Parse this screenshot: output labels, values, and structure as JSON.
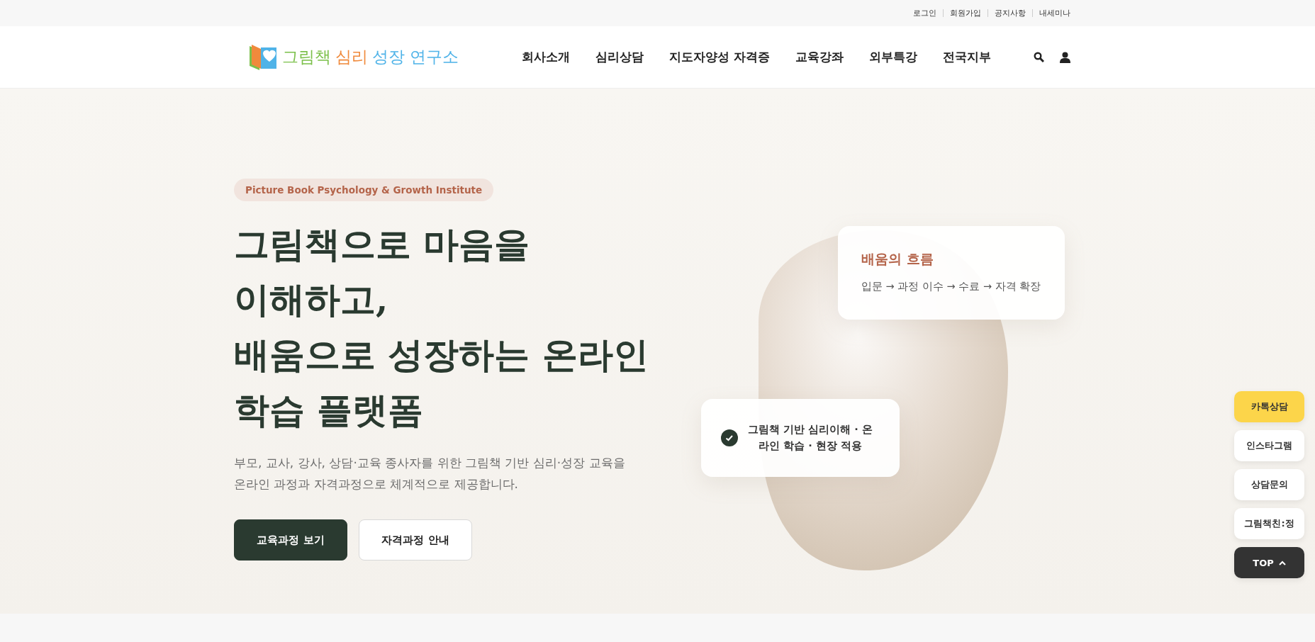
{
  "top_links": [
    "로그인",
    "회원가입",
    "공지사항",
    "내세미나"
  ],
  "logo": {
    "parts": [
      {
        "text": "그림책",
        "color": "#7cc04b"
      },
      {
        "text": "심리",
        "color": "#f08a3c"
      },
      {
        "text": "성장 연구소",
        "color": "#4fb3e8"
      }
    ]
  },
  "nav": [
    "회사소개",
    "심리상담",
    "지도자양성 자격증",
    "교육강좌",
    "외부특강",
    "전국지부"
  ],
  "hero": {
    "badge": "Picture Book Psychology & Growth Institute",
    "heading": [
      "그림책으로 마음을",
      "이해하고,",
      "배움으로 성장하는 온라인",
      "학습 플랫폼"
    ],
    "description": [
      "부모, 교사, 강사, 상담·교육 종사자를 위한 그림책 기반 심리·성장 교육을",
      "온라인 과정과 자격과정으로 체계적으로 제공합니다."
    ],
    "buttons": [
      {
        "label": "교육과정 보기",
        "kind": "primary"
      },
      {
        "label": "자격과정 안내",
        "kind": "secondary"
      }
    ],
    "flow_card": {
      "title": "배움의 흐름",
      "text": "입문 → 과정 이수 → 수료 → 자격 확장"
    },
    "check_card": {
      "text": "그림책 기반 심리이해 · 온라인 학습 · 현장 적용"
    }
  },
  "quick_menu": [
    {
      "label": "카톡상담",
      "kind": "yellow"
    },
    {
      "label": "인스타그램",
      "kind": "plain"
    },
    {
      "label": "상담문의",
      "kind": "plain"
    },
    {
      "label": "그림책친:정",
      "kind": "plain"
    },
    {
      "label": "TOP",
      "kind": "top"
    }
  ]
}
